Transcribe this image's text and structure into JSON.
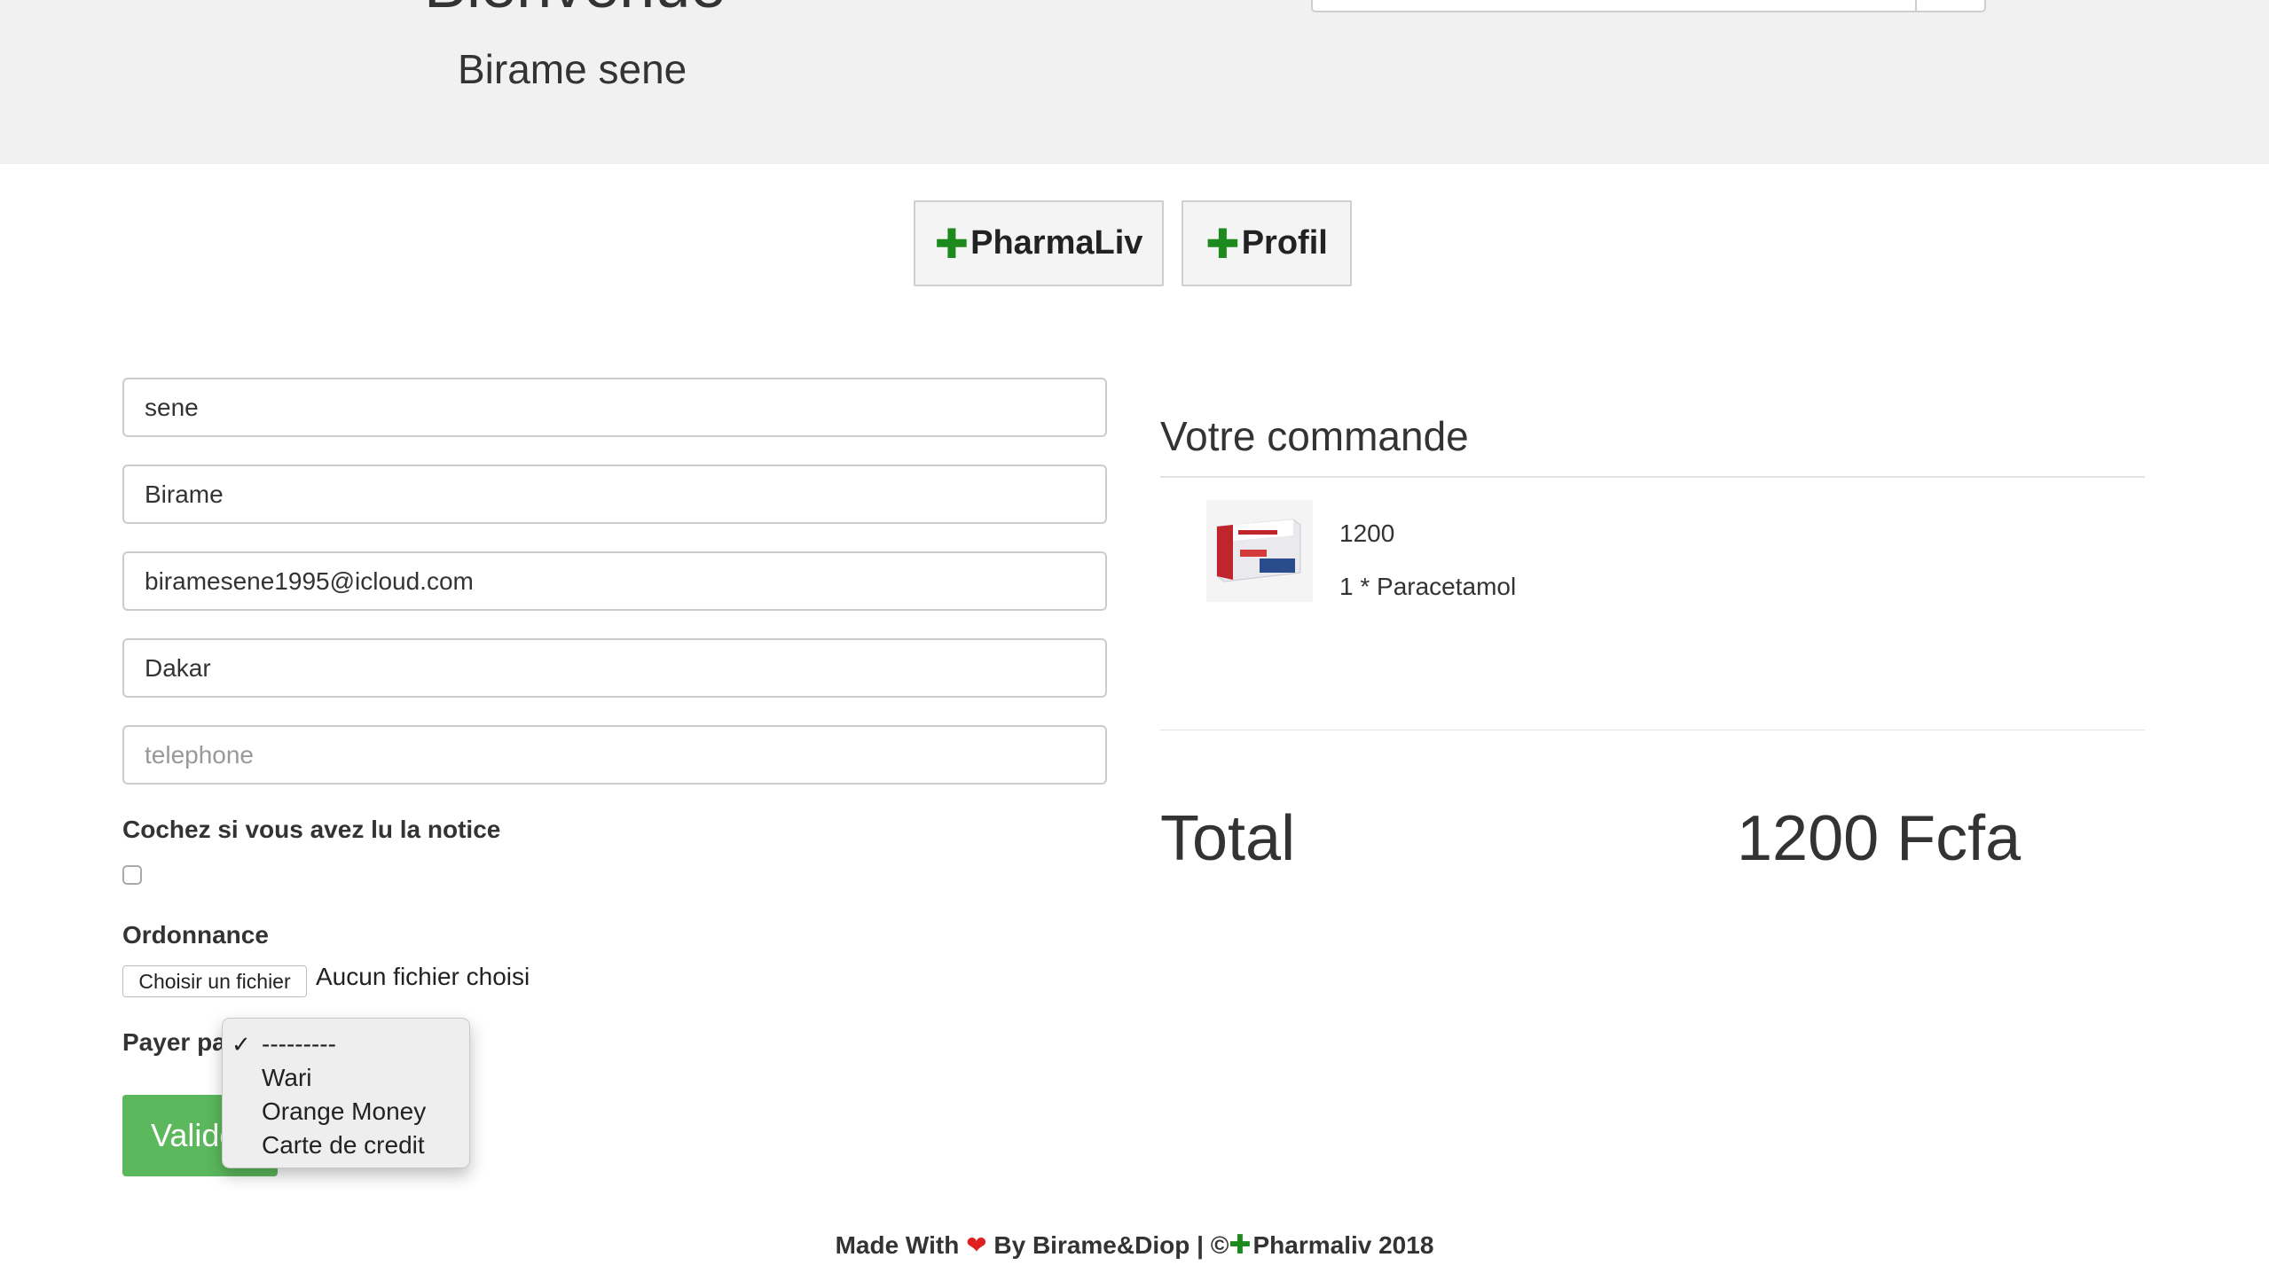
{
  "header": {
    "title": "Bienvenue",
    "user_name": "Birame sene"
  },
  "nav": {
    "pharmaliv_label": "PharmaLiv",
    "profil_label": "Profil",
    "icon": "plus-icon"
  },
  "form": {
    "nom_value": "sene",
    "prenom_value": "Birame",
    "email_value": "biramesene1995@icloud.com",
    "ville_value": "Dakar",
    "telephone_placeholder": "telephone",
    "notice_label": "Cochez si vous avez lu la notice",
    "notice_checked": false,
    "ordonnance_label": "Ordonnance",
    "file_button_label": "Choisir un fichier",
    "file_status": "Aucun fichier choisi",
    "payer_label": "Payer par",
    "payment_options": [
      "---------",
      "Wari",
      "Orange Money",
      "Carte de credit"
    ],
    "payment_selected": "---------",
    "submit_label": "Valider"
  },
  "order": {
    "title": "Votre commande",
    "item_price": "1200",
    "item_line": "1 * Paracetamol",
    "total_label": "Total",
    "total_value": "1200 Fcfa"
  },
  "footer": {
    "made_with": "Made With",
    "by": "By",
    "authors": "Birame&Diop",
    "copyright": "| ©",
    "brand_year": "Pharmaliv 2018"
  },
  "colors": {
    "accent_green": "#1d8a1d",
    "submit_green": "#5cb85c",
    "heart_red": "#e02020",
    "header_bg": "#f1f1f1"
  }
}
